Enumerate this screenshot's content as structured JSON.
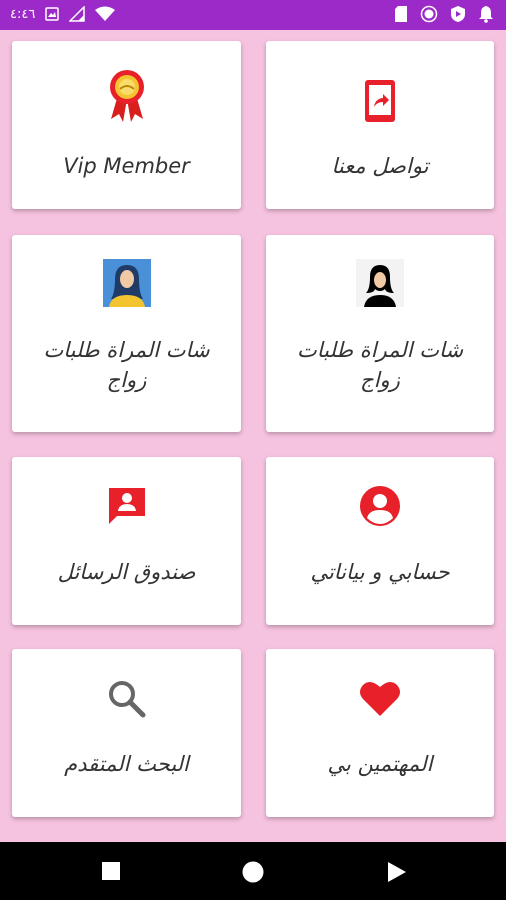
{
  "status_bar": {
    "time": "٤:٤٦",
    "bg_color": "#9b2ac9"
  },
  "cards": [
    {
      "label": "تواصل معنا",
      "icon": "share-phone-icon"
    },
    {
      "label": "Vip Member",
      "icon": "award-ribbon-icon"
    },
    {
      "label": "شات المراة طلبات زواج",
      "icon": "woman-silhouette-icon"
    },
    {
      "label": "شات المراة طلبات زواج",
      "icon": "woman-avatar-icon"
    },
    {
      "label": "حسابي و بياناتي",
      "icon": "account-circle-icon"
    },
    {
      "label": "صندوق الرسائل",
      "icon": "message-user-icon"
    },
    {
      "label": "المهتمين بي",
      "icon": "heart-icon"
    },
    {
      "label": "البحث المتقدم",
      "icon": "search-icon"
    }
  ],
  "colors": {
    "background": "#f5c2df",
    "accent_red": "#e8202a",
    "card": "#ffffff",
    "text": "#333333"
  },
  "nav_bar": {
    "buttons": [
      "recents-button",
      "home-button",
      "back-button"
    ]
  }
}
